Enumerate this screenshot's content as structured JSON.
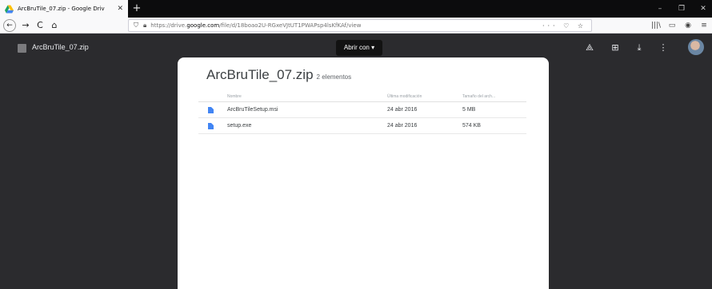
{
  "browser": {
    "tab": {
      "title": "ArcBruTile_07.zip - Google Driv",
      "close": "✕"
    },
    "new_tab": "+",
    "window": {
      "minimize": "–",
      "restore": "❐",
      "close": "✕"
    },
    "nav": {
      "back": "←",
      "forward": "→",
      "reload": "C",
      "home": "⌂"
    },
    "url": {
      "prefix": "https://drive.",
      "domain": "google.com",
      "path": "/file/d/18boao2U-RGxeVJtUT1PWAPsp4lsKfKAf/view",
      "actions": "··· ♡ ☆"
    },
    "toolbar_right": {
      "library": "|||\\",
      "sidebar": "▭",
      "extension": "◉",
      "menu": "≡"
    }
  },
  "viewer": {
    "file_name": "ArcBruTile_07.zip",
    "open_with": "Abrir con",
    "open_with_caret": "▾",
    "icons": {
      "add_to_drive": "⟁",
      "add": "⊞",
      "download": "⤓",
      "more": "⋮"
    }
  },
  "archive": {
    "title": "ArcBruTile_07.zip",
    "count": "2 elementos",
    "columns": {
      "name": "Nombre",
      "modified": "Última modificación",
      "size": "Tamaño del arch..."
    },
    "files": [
      {
        "name": "ArcBruTileSetup.msi",
        "modified": "24 abr 2016",
        "size": "5 MB"
      },
      {
        "name": "setup.exe",
        "modified": "24 abr 2016",
        "size": "574 KB"
      }
    ]
  }
}
